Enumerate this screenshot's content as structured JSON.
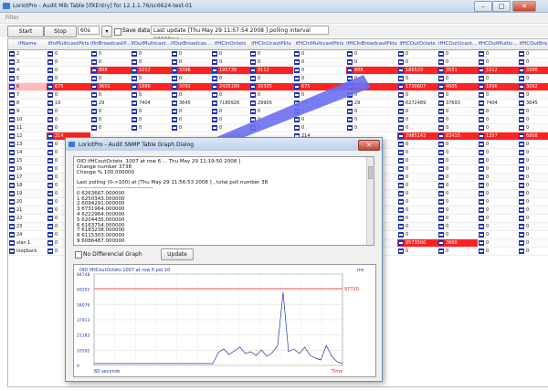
{
  "window": {
    "title": "LoriotPro - Audit Mib Table [ifXEntry] for 12.1.1.76/sc6624-test-01",
    "min": "–",
    "max": "□",
    "close": "✕"
  },
  "menu": {
    "file": "Filter"
  },
  "toolbar": {
    "start_label": "Start",
    "stop_label": "Stop",
    "interval_value": "60s",
    "save_label": "Save data",
    "status": "Last update [Thu May 29 11:57:54 2008 ] polling interval 60000ms"
  },
  "table": {
    "columns": [
      "ifName",
      "ifInMulticastPkts",
      "ifInBroadcastP...",
      "ifOutMulticast...",
      "ifOutBroadcas...",
      "ifHCInOctets",
      "ifHCInUcastPkts",
      "ifHCInMulticastPkts",
      "ifHCInBroadcastPkts",
      "ifHCOutOctets",
      "ifHCOutUcast...",
      "ifHCOutMultic...",
      "ifHCOutBro"
    ],
    "rows": [
      {
        "cells": [
          "2",
          "0",
          "0",
          "0",
          "0",
          "0",
          "0",
          "0",
          "0",
          "0",
          "0",
          "0",
          "0"
        ],
        "red": []
      },
      {
        "cells": [
          "3",
          "0",
          "0",
          "0",
          "0",
          "0",
          "0",
          "0",
          "0",
          "0",
          "0",
          "0",
          "0"
        ],
        "red": []
      },
      {
        "cells": [
          "4",
          "0",
          "888",
          "1012",
          "3396",
          "195739",
          "9112",
          "0",
          "888",
          "186523",
          "3551",
          "1012",
          "3396"
        ],
        "red": [
          2,
          3,
          4,
          5,
          6,
          8,
          9,
          10,
          11,
          12
        ]
      },
      {
        "cells": [
          "5",
          "0",
          "0",
          "0",
          "0",
          "0",
          "0",
          "0",
          "0",
          "0",
          "0",
          "0",
          "0"
        ],
        "red": []
      },
      {
        "cells": [
          "6",
          "675",
          "3601",
          "1896",
          "3092",
          "2435189",
          "20305",
          "675",
          "3601",
          "1730607",
          "4005",
          "1896",
          "3092"
        ],
        "red": [
          1,
          2,
          3,
          4,
          5,
          6,
          7,
          8,
          9,
          10,
          11,
          12
        ],
        "pink": [
          0
        ]
      },
      {
        "cells": [
          "7",
          "0",
          "0",
          "0",
          "0",
          "0",
          "0",
          "0",
          "0",
          "0",
          "0",
          "0",
          "0"
        ],
        "red": []
      },
      {
        "cells": [
          "8",
          "19",
          "29",
          "7404",
          "3645",
          "7180926",
          "29905",
          "19",
          "29",
          "6272489",
          "37693",
          "7404",
          "3645"
        ],
        "red": []
      },
      {
        "cells": [
          "9",
          "0",
          "0",
          "0",
          "0",
          "0",
          "0",
          "0",
          "0",
          "0",
          "0",
          "0",
          "0"
        ],
        "red": []
      },
      {
        "cells": [
          "10",
          "0",
          "0",
          "0",
          "0",
          "0",
          "0",
          "0",
          "0",
          "0",
          "0",
          "0",
          "0"
        ],
        "red": []
      },
      {
        "cells": [
          "11",
          "0",
          "0",
          "0",
          "0",
          "0",
          "0",
          "0",
          "0",
          "0",
          "0",
          "0",
          "0"
        ],
        "red": []
      },
      {
        "cells": [
          "12",
          "214",
          "",
          "",
          "",
          "",
          "",
          "214",
          "",
          "2985143",
          "83415",
          "1357",
          "6808"
        ],
        "red": [
          1,
          8,
          9,
          10,
          11,
          12
        ]
      },
      {
        "cells": [
          "13",
          "0",
          "",
          "",
          "",
          "",
          "",
          "",
          "",
          "0",
          "0",
          "0",
          "0"
        ],
        "red": []
      },
      {
        "cells": [
          "14",
          "0",
          "",
          "",
          "",
          "",
          "",
          "",
          "",
          "0",
          "0",
          "0",
          "0"
        ],
        "red": []
      },
      {
        "cells": [
          "15",
          "0",
          "",
          "",
          "",
          "",
          "",
          "",
          "",
          "0",
          "0",
          "0",
          "0"
        ],
        "red": []
      },
      {
        "cells": [
          "16",
          "0",
          "",
          "",
          "",
          "",
          "",
          "",
          "",
          "0",
          "0",
          "0",
          "0"
        ],
        "red": []
      },
      {
        "cells": [
          "17",
          "0",
          "",
          "",
          "",
          "",
          "",
          "",
          "",
          "0",
          "0",
          "0",
          "0"
        ],
        "red": []
      },
      {
        "cells": [
          "18",
          "0",
          "",
          "",
          "",
          "",
          "",
          "",
          "",
          "0",
          "0",
          "0",
          "0"
        ],
        "red": []
      },
      {
        "cells": [
          "19",
          "0",
          "",
          "",
          "",
          "",
          "",
          "",
          "",
          "0",
          "0",
          "0",
          "0"
        ],
        "red": []
      },
      {
        "cells": [
          "20",
          "0",
          "",
          "",
          "",
          "",
          "",
          "",
          "",
          "0",
          "0",
          "0",
          "0"
        ],
        "red": []
      },
      {
        "cells": [
          "21",
          "0",
          "",
          "",
          "",
          "",
          "",
          "",
          "",
          "0",
          "0",
          "0",
          "0"
        ],
        "red": []
      },
      {
        "cells": [
          "22",
          "0",
          "",
          "",
          "",
          "",
          "",
          "",
          "",
          "0",
          "0",
          "0",
          "0"
        ],
        "red": []
      },
      {
        "cells": [
          "23",
          "0",
          "",
          "",
          "",
          "",
          "",
          "",
          "",
          "0",
          "0",
          "0",
          "0"
        ],
        "red": []
      },
      {
        "cells": [
          "24",
          "0",
          "",
          "",
          "",
          "",
          "",
          "",
          "",
          "0",
          "0",
          "0",
          "0"
        ],
        "red": []
      },
      {
        "cells": [
          "vlan 1",
          "0",
          "",
          "",
          "",
          "",
          "",
          "",
          "",
          "9573500",
          "3660",
          "0",
          "0"
        ],
        "red": [
          9,
          10
        ]
      },
      {
        "cells": [
          "loopback",
          "0",
          "",
          "",
          "",
          "",
          "",
          "",
          "",
          "0",
          "0",
          "0",
          "0"
        ],
        "red": []
      }
    ]
  },
  "dialog": {
    "title": "LoriotPro - Audit SNMP Table Graph Dialog",
    "close": "✕",
    "text_lines": [
      "OID ifHCoutOctets .1007 at row 6 ... Thu May 29 11:19:50 2008 ]",
      "Change number  3738",
      "Change %  100.000000",
      "",
      "Last polling (0->100) at [Thu May 29 11:56:53 2008 ] , total poll number 38",
      "------------------------------------------",
      "0 6263667.000000",
      "1 6250343.000000",
      "2 6094291.000000",
      "3 6731964.000000",
      "4 6222964.000000",
      "5 6204435.000000",
      "6 6163754.000000",
      "7 6183238.000000",
      "8 6115303.000000",
      "9 6086487.000000"
    ],
    "no_diff_label": "No Differencial Graph",
    "update_label": "Update",
    "graph": {
      "header": "OID ifHCoutOctets 1007 at row 6 pol 10",
      "units": "ms",
      "max_label": "97720",
      "x_left": "60 seconds",
      "x_right": "Time",
      "yticks": [
        "84748",
        "69292",
        "58076",
        "37913",
        "21183",
        "10592",
        "0"
      ]
    }
  },
  "colors": {
    "accent": "#2233aa",
    "alert": "#ff2222",
    "arrow": "#6a6ff0"
  }
}
